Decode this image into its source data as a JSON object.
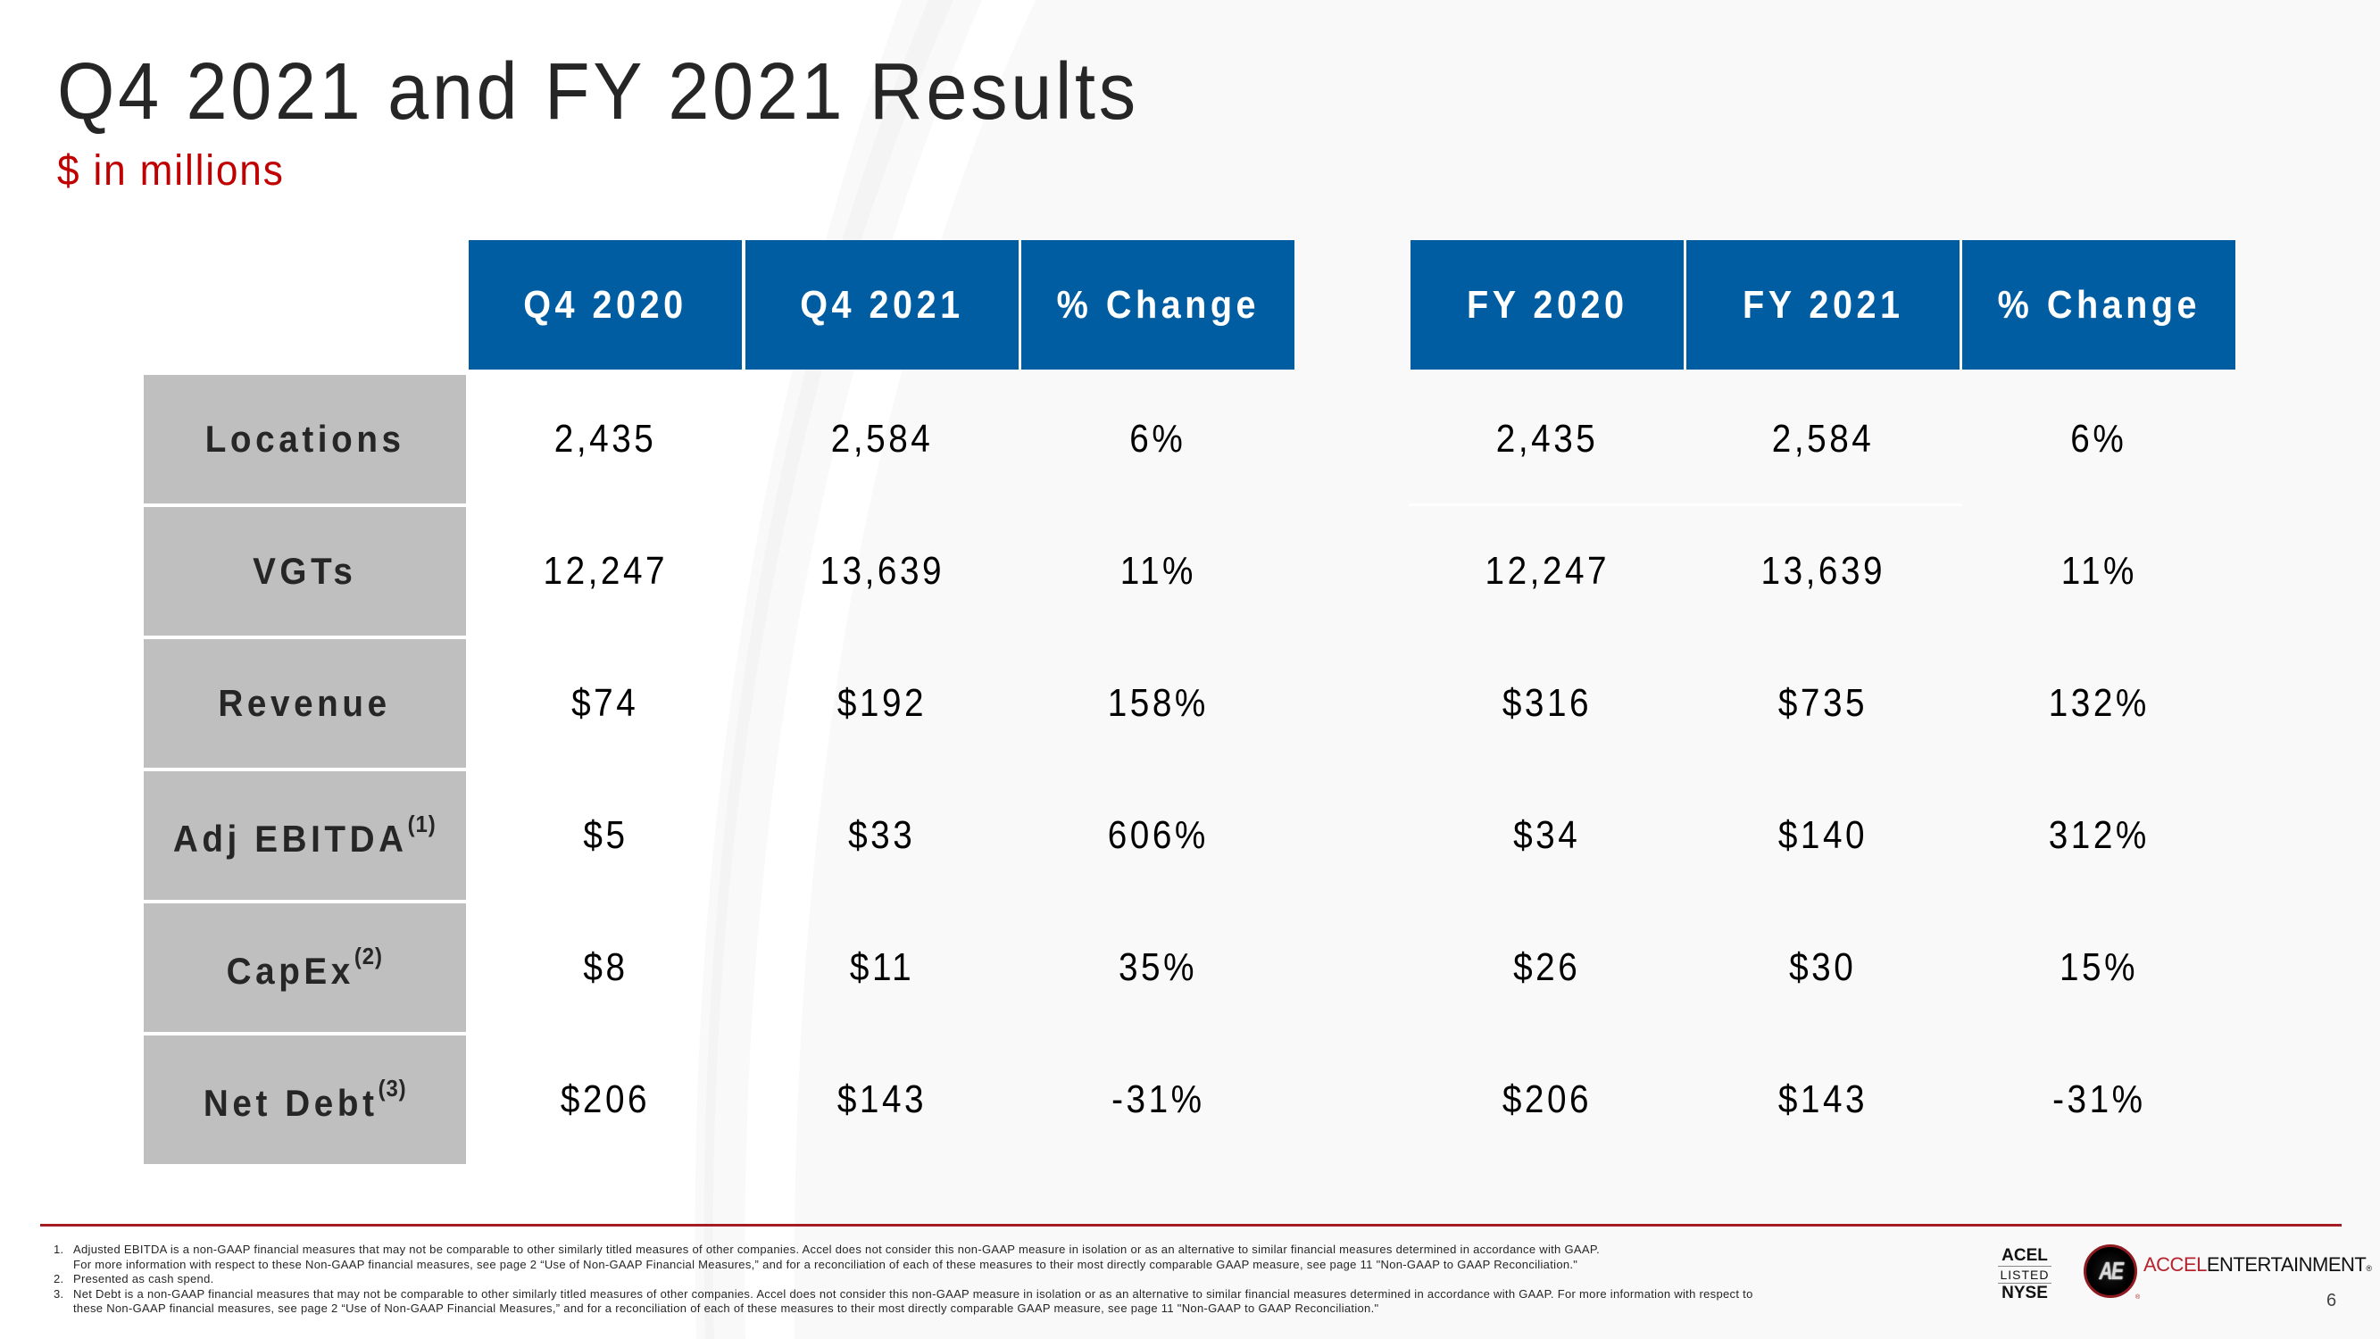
{
  "header": {
    "title": "Q4 2021 and FY 2021 Results",
    "subtitle": "$ in millions"
  },
  "colors": {
    "header_fill": "#005DA2",
    "label_fill": "#BFBFBF",
    "subtitle": "#C00000",
    "accent_red": "#A51C24"
  },
  "table": {
    "columns": [
      "Q4 2020",
      "Q4 2021",
      "% Change",
      "FY 2020",
      "FY 2021",
      "% Change"
    ],
    "rows": [
      {
        "label": "Locations",
        "note": "",
        "values": [
          "2,435",
          "2,584",
          "6%",
          "2,435",
          "2,584",
          "6%"
        ]
      },
      {
        "label": "VGTs",
        "note": "",
        "values": [
          "12,247",
          "13,639",
          "11%",
          "12,247",
          "13,639",
          "11%"
        ]
      },
      {
        "label": "Revenue",
        "note": "",
        "values": [
          "$74",
          "$192",
          "158%",
          "$316",
          "$735",
          "132%"
        ]
      },
      {
        "label": "Adj EBITDA",
        "note": "(1)",
        "values": [
          "$5",
          "$33",
          "606%",
          "$34",
          "$140",
          "312%"
        ]
      },
      {
        "label": "CapEx",
        "note": "(2)",
        "values": [
          "$8",
          "$11",
          "35%",
          "$26",
          "$30",
          "15%"
        ]
      },
      {
        "label": "Net Debt",
        "note": "(3)",
        "values": [
          "$206",
          "$143",
          "-31%",
          "$206",
          "$143",
          "-31%"
        ]
      }
    ]
  },
  "footnotes": [
    {
      "num": "1.",
      "lines": [
        "Adjusted EBITDA is a non-GAAP financial measures that may not be comparable to other similarly titled measures of other companies. Accel does not consider this non-GAAP measure in isolation or as an alternative to similar financial measures determined in accordance with GAAP.",
        "For more information with respect  to these Non-GAAP financial measures, see page 2 “Use of Non-GAAP Financial Measures,” and for a reconciliation of each of these measures to their most directly comparable GAAP measure, see page 11 \"Non-GAAP to GAAP Reconciliation.\""
      ]
    },
    {
      "num": "2.",
      "lines": [
        "Presented as cash spend."
      ]
    },
    {
      "num": "3.",
      "lines": [
        "Net Debt is a non-GAAP financial measures that may not be comparable to other similarly titled measures of other companies. Accel does not consider this non-GAAP measure in isolation or as an alternative to similar financial measures determined in accordance with GAAP. For more information with respect  to",
        "these Non-GAAP financial measures, see page 2 “Use of Non-GAAP Financial Measures,” and for a reconciliation of each of these measures to their most directly comparable GAAP measure, see page 11 \"Non-GAAP to GAAP Reconciliation.\""
      ]
    }
  ],
  "footer": {
    "listed_badge": {
      "ticker": "ACEL",
      "listed": "LISTED",
      "exchange": "NYSE"
    },
    "logo_monogram": "AE",
    "brand_part1": "ACCEL",
    "brand_part2": "ENTERTAINMENT",
    "registered_mark": "®",
    "page_number": "6"
  }
}
